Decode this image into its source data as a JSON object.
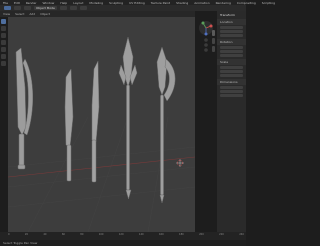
{
  "menu": {
    "items": [
      "File",
      "Edit",
      "Render",
      "Window",
      "Help",
      "Layout",
      "Modeling",
      "Sculpting",
      "UV Editing",
      "Texture Paint",
      "Shading",
      "Animation",
      "Rendering",
      "Compositing",
      "Scripting"
    ]
  },
  "toolbar": {
    "mode": "Object Mode"
  },
  "header": {
    "items": [
      "View",
      "Select",
      "Add",
      "Object"
    ]
  },
  "properties": {
    "title": "Transform",
    "sections": [
      "Location",
      "Rotation",
      "Scale",
      "Dimensions"
    ]
  },
  "timeline": {
    "ticks": [
      "0",
      "20",
      "40",
      "60",
      "80",
      "100",
      "120",
      "140",
      "160",
      "180",
      "200",
      "220",
      "240"
    ]
  },
  "status": {
    "text": "Select Toggle Pan View"
  },
  "colors": {
    "viewport": "#3d3d3d",
    "object": "#9a9a9a",
    "accent": "#4a6a9a"
  }
}
